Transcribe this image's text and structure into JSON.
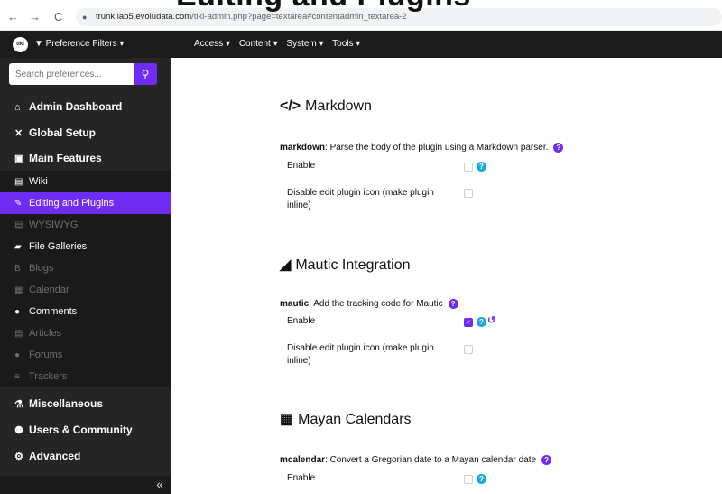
{
  "browser": {
    "back_glyph": "←",
    "forward_glyph": "→",
    "reload_glyph": "C",
    "url_host": "trunk.lab5.evoludata.com",
    "url_path": "/tiki-admin.php?page=textarea#contentadmin_textarea-2"
  },
  "overlay_title": "Editing and Plugins",
  "topbar": {
    "logo_text": "tiki",
    "pref_filters": "▼ Preference Filters ▾",
    "menu": [
      "Access ▾",
      "Content ▾",
      "System ▾",
      "Tools ▾"
    ]
  },
  "sidebar": {
    "search_placeholder": "Search preferences...",
    "search_icon": "search-icon",
    "items": [
      {
        "label": "Admin Dashboard",
        "icon": "home-icon",
        "glyph": "⌂"
      },
      {
        "label": "Global Setup",
        "icon": "tools-icon",
        "glyph": "✕"
      },
      {
        "label": "Main Features",
        "icon": "briefcase-icon",
        "glyph": "▣"
      }
    ],
    "sub_items": [
      {
        "label": "Wiki",
        "icon": "file-icon",
        "glyph": "▤"
      },
      {
        "label": "Editing and Plugins",
        "icon": "edit-icon",
        "glyph": "✎"
      },
      {
        "label": "WYSIWYG",
        "icon": "file-icon",
        "glyph": "▤"
      },
      {
        "label": "File Galleries",
        "icon": "folder-icon",
        "glyph": "▰"
      },
      {
        "label": "Blogs",
        "icon": "bold-icon",
        "glyph": "B"
      },
      {
        "label": "Calendar",
        "icon": "calendar-icon",
        "glyph": "▦"
      },
      {
        "label": "Comments",
        "icon": "comment-icon",
        "glyph": "●"
      },
      {
        "label": "Articles",
        "icon": "newspaper-icon",
        "glyph": "▤"
      },
      {
        "label": "Forums",
        "icon": "comments-icon",
        "glyph": "●"
      },
      {
        "label": "Trackers",
        "icon": "database-icon",
        "glyph": "≡"
      }
    ],
    "items_bottom": [
      {
        "label": "Miscellaneous",
        "icon": "flask-icon",
        "glyph": "⚗"
      },
      {
        "label": "Users & Community",
        "icon": "users-icon",
        "glyph": "⚉"
      },
      {
        "label": "Advanced",
        "icon": "cogs-icon",
        "glyph": "⚙"
      }
    ],
    "collapse_glyph": "«"
  },
  "sections": [
    {
      "glyph": "</>",
      "icon": "code-icon",
      "title": "Markdown",
      "pref_key": "markdown",
      "pref_desc": ": Parse the body of the plugin using a Markdown parser.",
      "enable_label": "Enable",
      "enable_checked": false,
      "disable_label": "Disable edit plugin icon (make plugin inline)",
      "disable_checked": false
    },
    {
      "glyph": "◢",
      "icon": "chart-area-icon",
      "title": "Mautic Integration",
      "pref_key": "mautic",
      "pref_desc": ": Add the tracking code for Mautic",
      "enable_label": "Enable",
      "enable_checked": true,
      "disable_label": "Disable edit plugin icon (make plugin inline)",
      "disable_checked": false
    },
    {
      "glyph": "▦",
      "icon": "calendar-icon",
      "title": "Mayan Calendars",
      "pref_key": "mcalendar",
      "pref_desc": ": Convert a Gregorian date to a Mayan calendar date",
      "enable_label": "Enable",
      "enable_checked": false
    }
  ],
  "help_glyph": "?",
  "check_glyph": "✓",
  "reset_glyph": "↺",
  "colors": {
    "accent": "#6f2cf3",
    "info": "#1ba9e1",
    "sidebar": "#252525",
    "topbar": "#1c1c1c"
  }
}
